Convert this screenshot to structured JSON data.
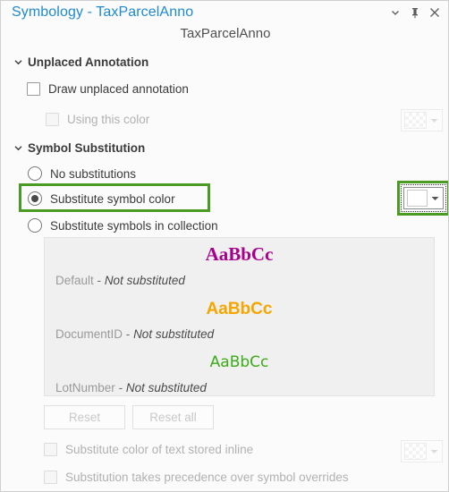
{
  "window": {
    "title": "Symbology - TaxParcelAnno",
    "layer_name": "TaxParcelAnno",
    "controls": {
      "menu_label": "chevron-down",
      "pin_label": "pin",
      "close_label": "close"
    },
    "accent_color": "#1f8ad2",
    "highlight_color": "#4a9b22"
  },
  "unplaced": {
    "header": "Unplaced Annotation",
    "draw_unplaced": {
      "label": "Draw unplaced annotation",
      "checked": false,
      "enabled": true
    },
    "using_this_color": {
      "label": "Using this color",
      "checked": false,
      "enabled": false
    }
  },
  "substitution": {
    "header": "Symbol Substitution",
    "options": [
      {
        "label": "No substitutions",
        "selected": false
      },
      {
        "label": "Substitute symbol color",
        "selected": true
      },
      {
        "label": "Substitute symbols in collection",
        "selected": false
      }
    ],
    "color_swatch_value": "#ffffff",
    "items": [
      {
        "preview_text": "AaBbCc",
        "preview_color": "#a8008e",
        "name": "Default",
        "separator": "-",
        "status": "Not substituted"
      },
      {
        "preview_text": "AaBbCc",
        "preview_color": "#f5a600",
        "name": "DocumentID",
        "separator": "-",
        "status": "Not substituted"
      },
      {
        "preview_text": "AaBbCc",
        "preview_color": "#3bab18",
        "name": "LotNumber",
        "separator": "-",
        "status": "Not substituted"
      }
    ],
    "reset_button": "Reset",
    "reset_all_button": "Reset all",
    "inline_text": {
      "label": "Substitute color of text stored inline",
      "checked": false,
      "enabled": false
    },
    "precedence": {
      "label": "Substitution takes precedence over symbol overrides",
      "checked": false,
      "enabled": false
    }
  }
}
